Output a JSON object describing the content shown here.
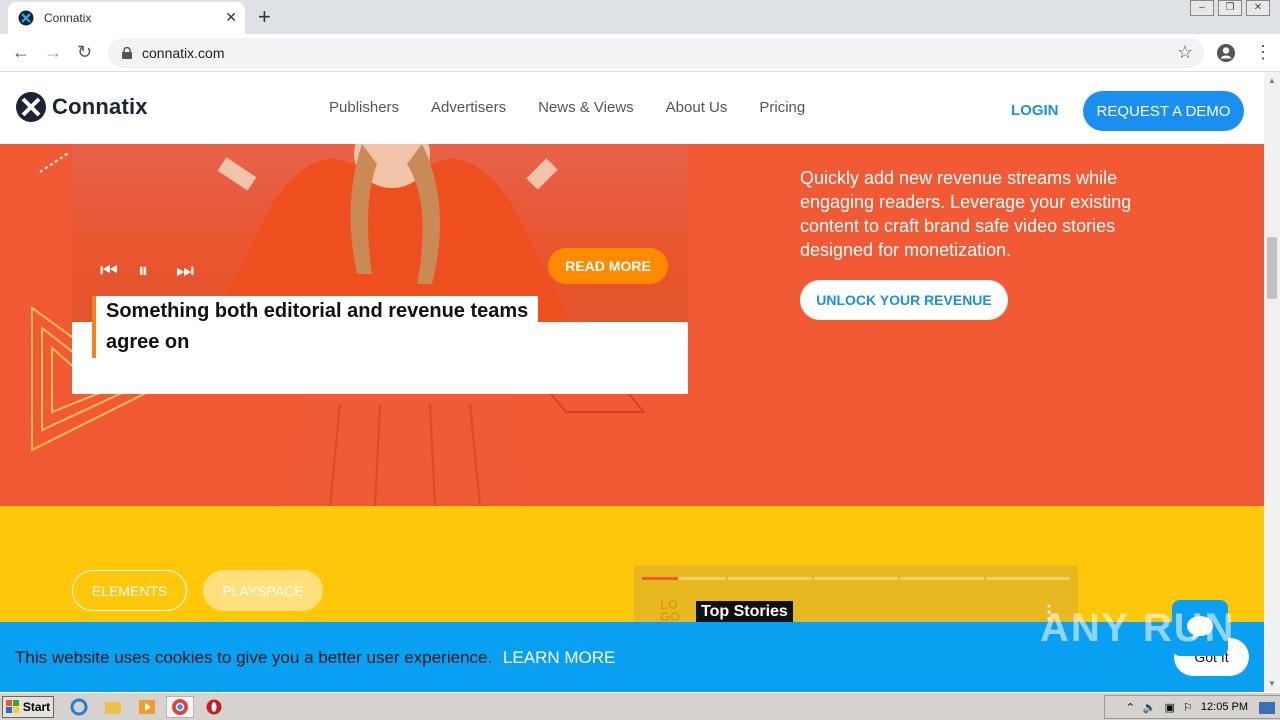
{
  "browser": {
    "tab_title": "Connatix",
    "url": "connatix.com"
  },
  "header": {
    "brand": "Connatix",
    "menu": [
      "Publishers",
      "Advertisers",
      "News & Views",
      "About Us",
      "Pricing"
    ],
    "login": "LOGIN",
    "demo": "REQUEST A DEMO"
  },
  "hero": {
    "read_more": "READ MORE",
    "caption_line1": "Something both editorial and revenue teams",
    "caption_line2": "agree on",
    "description": "Quickly add new revenue streams while engaging readers. Leverage your existing content to craft brand safe video stories designed for monetization.",
    "cta": "UNLOCK YOUR REVENUE"
  },
  "yellow": {
    "tab_elements": "ELEMENTS",
    "tab_playspace": "PLAYSPACE",
    "widget_logo": "LO GO",
    "top_stories": "Top Stories"
  },
  "cookie": {
    "text": "This website uses cookies to give you a better user experience.",
    "learn_more": "LEARN MORE",
    "got_it": "Got It"
  },
  "watermark": "ANY RUN",
  "taskbar": {
    "start": "Start",
    "clock": "12:05 PM"
  },
  "colors": {
    "hero_bg": "#f25a36",
    "yellow_bg": "#ffc70a",
    "accent_blue": "#1a8ff0",
    "read_more": "#ff8a00"
  }
}
